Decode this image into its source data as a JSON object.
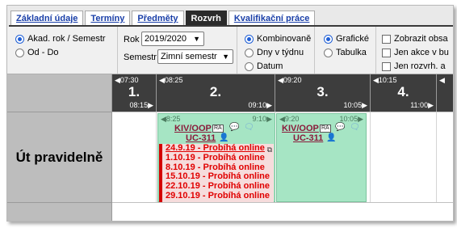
{
  "tabs": [
    {
      "label": "Základní údaje",
      "active": false
    },
    {
      "label": "Termíny",
      "active": false
    },
    {
      "label": "Předměty",
      "active": false
    },
    {
      "label": "Rozvrh",
      "active": true
    },
    {
      "label": "Kvalifikační práce",
      "active": false
    }
  ],
  "filters": {
    "period_radio": [
      {
        "label": "Akad. rok / Semestr",
        "checked": true
      },
      {
        "label": "Od - Do",
        "checked": false
      }
    ],
    "rok_label": "Rok",
    "rok_value": "2019/2020",
    "semestr_label": "Semestr",
    "semestr_value": "Zimní semestr",
    "view_radio": [
      {
        "label": "Kombinovaně",
        "checked": true
      },
      {
        "label": "Dny v týdnu",
        "checked": false
      },
      {
        "label": "Datum",
        "checked": false
      }
    ],
    "format_radio": [
      {
        "label": "Grafické",
        "checked": true
      },
      {
        "label": "Tabulka",
        "checked": false
      }
    ],
    "checkboxes": [
      {
        "label": "Zobrazit obsa",
        "checked": false
      },
      {
        "label": "Jen akce v bu",
        "checked": false
      },
      {
        "label": "Jen rozvrh. a",
        "checked": false
      }
    ]
  },
  "header_slots": [
    {
      "start": "07:30",
      "number": "1.",
      "end": "08:15"
    },
    {
      "start": "08:25",
      "number": "2.",
      "end": "09:10"
    },
    {
      "start": "09:20",
      "number": "3.",
      "end": "10:05"
    },
    {
      "start": "10:15",
      "number": "4.",
      "end": "11:00"
    },
    {
      "start": "",
      "number": "",
      "end": ""
    }
  ],
  "row_label": "Út pravidelně",
  "events": [
    {
      "start": "8:25",
      "end": "9:10",
      "course": "KIV/OOP",
      "badge": "RA",
      "room": "UC-311",
      "online": [
        "24.9.19 - Probíhá online",
        "1.10.19 - Probíhá online",
        "8.10.19 - Probíhá online",
        "15.10.19 - Probíhá online",
        "22.10.19 - Probíhá online",
        "29.10.19 - Probíhá online"
      ]
    },
    {
      "start": "9:20",
      "end": "10:05",
      "course": "KIV/OOP",
      "badge": "RA",
      "room": "UC-311"
    }
  ],
  "icons": {
    "comment": "speech-bubble",
    "chat": "chat-bubble",
    "person": "person",
    "external": "external-link",
    "triangle": "left-triangle"
  }
}
